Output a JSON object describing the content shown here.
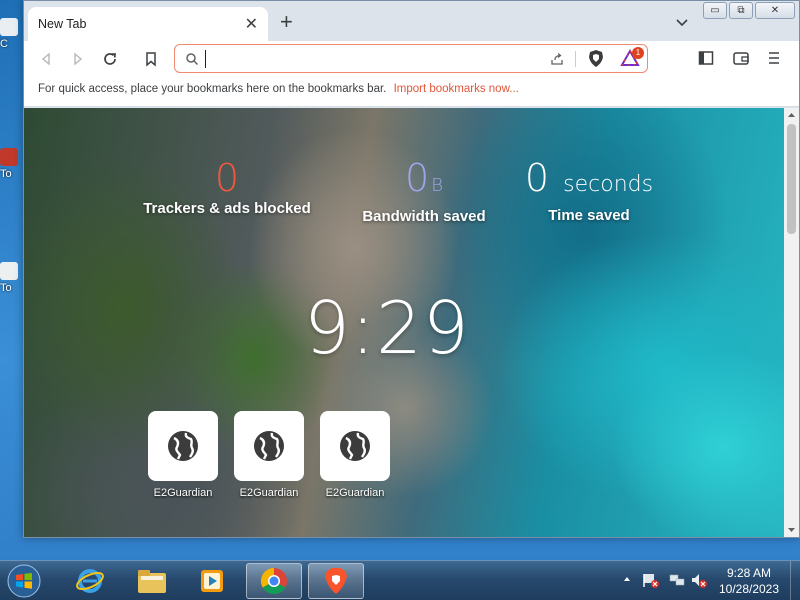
{
  "desktop": {
    "icon_labels": [
      "C",
      "To",
      "To"
    ]
  },
  "browser": {
    "tab": {
      "title": "New Tab"
    },
    "window_controls": {
      "minimize": "▭",
      "restore": "⧉",
      "close": "✕"
    },
    "address_bar": {
      "value": "",
      "placeholder": ""
    },
    "rewards_badge": "1",
    "bookmarks_bar": {
      "message": "For quick access, place your bookmarks here on the bookmarks bar.",
      "link": "Import bookmarks now..."
    }
  },
  "newtab": {
    "stats": [
      {
        "value": "0",
        "unit": "",
        "label": "Trackers & ads blocked",
        "color": "#f0593e"
      },
      {
        "value": "0",
        "unit": "B",
        "label": "Bandwidth saved",
        "color": "#a0a5eb"
      },
      {
        "value": "0",
        "unit": "seconds",
        "label": "Time saved",
        "color": "#ffffff"
      }
    ],
    "clock": "9:29",
    "top_sites": [
      {
        "label": "E2Guardian",
        "icon": "globe-icon"
      },
      {
        "label": "E2Guardian",
        "icon": "globe-icon"
      },
      {
        "label": "E2Guardian",
        "icon": "globe-icon"
      }
    ]
  },
  "taskbar": {
    "apps": [
      "internet-explorer",
      "file-explorer",
      "media-player",
      "chrome",
      "brave"
    ],
    "time": "9:28 AM",
    "date": "10/28/2023"
  },
  "colors": {
    "accent_orange": "#f0593e",
    "bandwidth_purple": "#a0a5eb",
    "url_border": "#f08a70"
  }
}
